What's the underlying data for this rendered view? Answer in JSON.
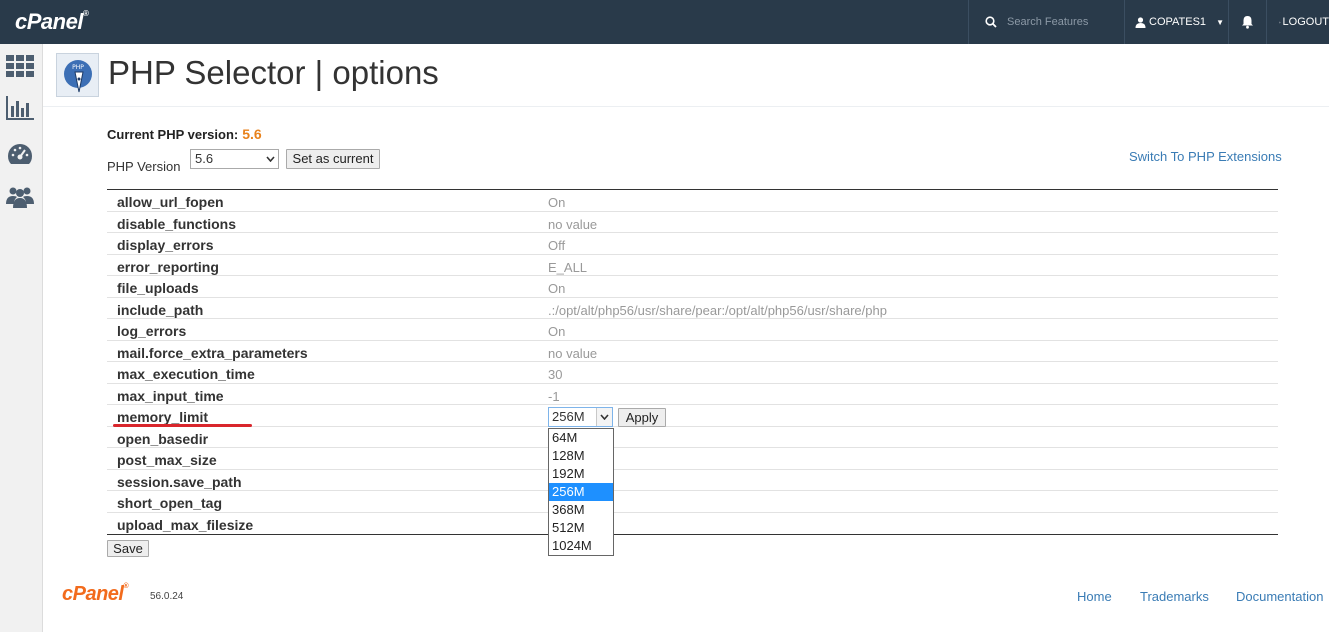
{
  "topbar": {
    "logo": "cPanel",
    "search_placeholder": "Search Features",
    "user": "COPATES1",
    "logout": "LOGOUT"
  },
  "sidebar": {
    "icons": [
      "grid-icon",
      "stats-icon",
      "dashboard-icon",
      "users-icon"
    ]
  },
  "page": {
    "title": "PHP Selector | options",
    "current_version_label": "Current PHP version:",
    "current_version": "5.6",
    "version_label": "PHP Version",
    "version_selected": "5.6",
    "set_current_label": "Set as current",
    "switch_link": "Switch To PHP Extensions"
  },
  "options": [
    {
      "name": "allow_url_fopen",
      "value": "On"
    },
    {
      "name": "disable_functions",
      "value": "no value"
    },
    {
      "name": "display_errors",
      "value": "Off"
    },
    {
      "name": "error_reporting",
      "value": "E_ALL"
    },
    {
      "name": "file_uploads",
      "value": "On"
    },
    {
      "name": "include_path",
      "value": ".:/opt/alt/php56/usr/share/pear:/opt/alt/php56/usr/share/php"
    },
    {
      "name": "log_errors",
      "value": "On"
    },
    {
      "name": "mail.force_extra_parameters",
      "value": "no value"
    },
    {
      "name": "max_execution_time",
      "value": "30"
    },
    {
      "name": "max_input_time",
      "value": "-1"
    },
    {
      "name": "memory_limit",
      "value": ""
    },
    {
      "name": "open_basedir",
      "value": ""
    },
    {
      "name": "post_max_size",
      "value": ""
    },
    {
      "name": "session.save_path",
      "value": ""
    },
    {
      "name": "short_open_tag",
      "value": ""
    },
    {
      "name": "upload_max_filesize",
      "value": ""
    }
  ],
  "memory_limit": {
    "selected": "256M",
    "apply_label": "Apply",
    "options": [
      "64M",
      "128M",
      "192M",
      "256M",
      "368M",
      "512M",
      "1024M"
    ]
  },
  "save_label": "Save",
  "footer": {
    "logo": "cPanel",
    "version": "56.0.24",
    "links": [
      "Home",
      "Trademarks",
      "Documentation"
    ]
  },
  "colors": {
    "topbar": "#293a4a",
    "accent_orange": "#e8821c",
    "link_blue": "#3a7cb5",
    "highlight": "#1e90ff",
    "annotation_red": "#d9262c"
  }
}
